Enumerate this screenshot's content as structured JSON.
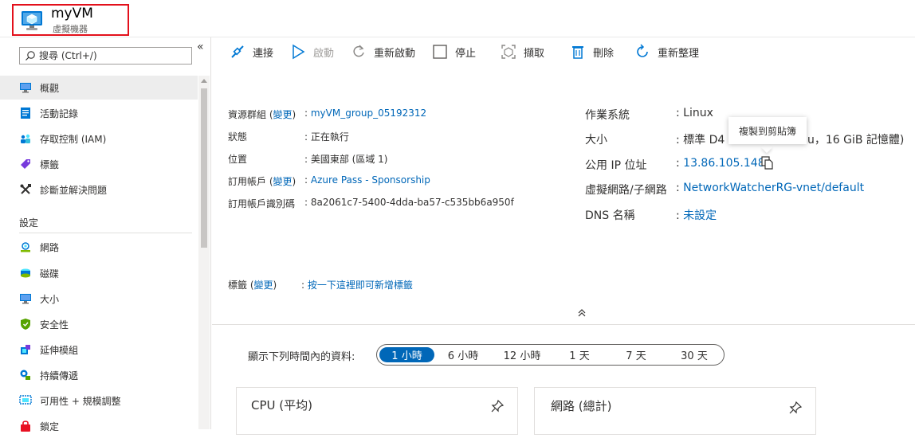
{
  "header": {
    "vm_name": "myVM",
    "vm_type": "虛擬機器",
    "highlight_color": "#e3101b"
  },
  "sidebar": {
    "search_placeholder": "搜尋 (Ctrl+/)",
    "collapse_glyph": "«",
    "items": [
      {
        "label": "概觀",
        "icon": "monitor-icon"
      },
      {
        "label": "活動記錄",
        "icon": "log-icon"
      },
      {
        "label": "存取控制 (IAM)",
        "icon": "people-icon"
      },
      {
        "label": "標籤",
        "icon": "tag-icon"
      },
      {
        "label": "診斷並解決問題",
        "icon": "wrench-icon"
      }
    ],
    "section_settings": "設定",
    "settings_items": [
      {
        "label": "網路",
        "icon": "network-icon"
      },
      {
        "label": "磁碟",
        "icon": "disk-icon"
      },
      {
        "label": "大小",
        "icon": "size-icon"
      },
      {
        "label": "安全性",
        "icon": "shield-icon"
      },
      {
        "label": "延伸模組",
        "icon": "extensions-icon"
      },
      {
        "label": "持續傳遞",
        "icon": "delivery-icon"
      },
      {
        "label": "可用性 + 規模調整",
        "icon": "availability-icon"
      },
      {
        "label": "鎖定",
        "icon": "lock-icon"
      }
    ]
  },
  "toolbar": {
    "connect": "連接",
    "start": "啟動",
    "restart": "重新啟動",
    "stop": "停止",
    "capture": "擷取",
    "delete": "刪除",
    "refresh": "重新整理"
  },
  "essentials": {
    "left": [
      {
        "label": "資源群組",
        "change": "變更",
        "value": "myVM_group_05192312",
        "is_link": true
      },
      {
        "label": "狀態",
        "value": "正在執行",
        "is_link": false
      },
      {
        "label": "位置",
        "value": "美國東部 (區域 1)",
        "is_link": false
      },
      {
        "label": "訂用帳戶",
        "change": "變更",
        "value": "Azure Pass - Sponsorship",
        "is_link": true
      },
      {
        "label": "訂用帳戶識別碼",
        "value": "8a2061c7-5400-4dda-ba57-c535bb6a950f",
        "is_link": false
      }
    ],
    "right": [
      {
        "label": "作業系統",
        "value": "Linux",
        "is_link": false
      },
      {
        "label": "大小",
        "value_prefix": "標準 D4",
        "value_suffix": "u，16 GiB 記憶體)",
        "is_link": false
      },
      {
        "label": "公用 IP 位址",
        "value": "13.86.105.148",
        "is_link": true
      },
      {
        "label": "虛擬網路/子網路",
        "value": "NetworkWatcherRG-vnet/default",
        "is_link": true
      },
      {
        "label": "DNS 名稱",
        "value": "未設定",
        "is_link": true
      }
    ],
    "tags_label": "標籤",
    "tags_change": "變更",
    "tags_value": "按一下這裡即可新增標籤",
    "tooltip": "複製到剪貼簿",
    "collapse_glyph": "⌃"
  },
  "time_range": {
    "label": "顯示下列時間內的資料:",
    "options": [
      "1 小時",
      "6 小時",
      "12 小時",
      "1 天",
      "7 天",
      "30 天"
    ],
    "selected": "1 小時"
  },
  "tiles": [
    {
      "title": "CPU (平均)"
    },
    {
      "title": "網路 (總計)"
    }
  ],
  "colors": {
    "link": "#0067b8",
    "accent": "#0067b8",
    "selected_nav_bg": "#ededed"
  }
}
